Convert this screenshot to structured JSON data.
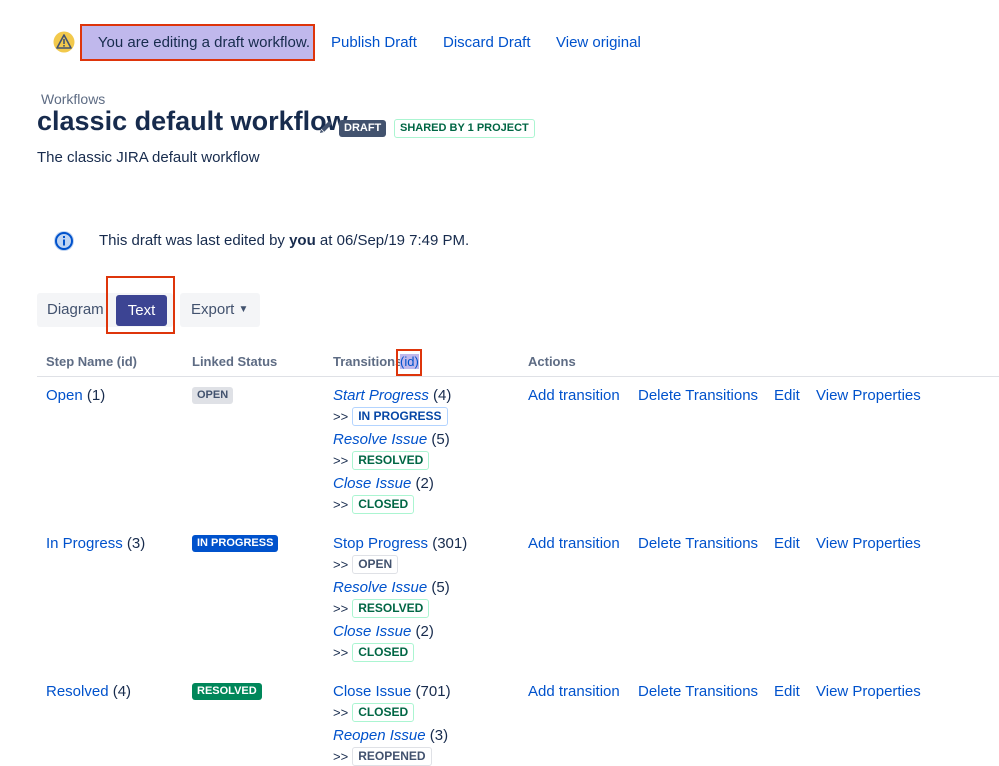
{
  "draft_bar": {
    "message": "You are editing a draft workflow.",
    "publish": "Publish Draft",
    "discard": "Discard Draft",
    "view_original": "View original"
  },
  "breadcrumb": "Workflows",
  "title": "classic default workflow",
  "badges": {
    "draft": "DRAFT",
    "shared": "SHARED BY 1 PROJECT"
  },
  "description": "The classic JIRA default workflow",
  "info": {
    "prefix": "This draft was last edited by ",
    "who": "you",
    "suffix": " at 06/Sep/19 7:49 PM."
  },
  "tabs": {
    "diagram": "Diagram",
    "text": "Text",
    "export": "Export"
  },
  "table": {
    "headers": {
      "step": "Step Name (id)",
      "status": "Linked Status",
      "transitions": "Transitions",
      "transitions_id": "(id)",
      "actions": "Actions"
    },
    "actions": {
      "add": "Add transition",
      "delete": "Delete Transitions",
      "edit": "Edit",
      "props": "View Properties"
    },
    "arrow": ">>",
    "rows": [
      {
        "step": "Open",
        "step_id": "(1)",
        "status": "OPEN",
        "transitions": [
          {
            "name": "Start Progress",
            "id": "(4)",
            "target": "IN PROGRESS"
          },
          {
            "name": "Resolve Issue",
            "id": "(5)",
            "target": "RESOLVED"
          },
          {
            "name": "Close Issue",
            "id": "(2)",
            "target": "CLOSED"
          }
        ]
      },
      {
        "step": "In Progress",
        "step_id": "(3)",
        "status": "IN PROGRESS",
        "transitions": [
          {
            "name": "Stop Progress",
            "id": "(301)",
            "target": "OPEN"
          },
          {
            "name": "Resolve Issue",
            "id": "(5)",
            "target": "RESOLVED"
          },
          {
            "name": "Close Issue",
            "id": "(2)",
            "target": "CLOSED"
          }
        ]
      },
      {
        "step": "Resolved",
        "step_id": "(4)",
        "status": "RESOLVED",
        "transitions": [
          {
            "name": "Close Issue",
            "id": "(701)",
            "target": "CLOSED"
          },
          {
            "name": "Reopen Issue",
            "id": "(3)",
            "target": "REOPENED"
          }
        ]
      }
    ]
  }
}
